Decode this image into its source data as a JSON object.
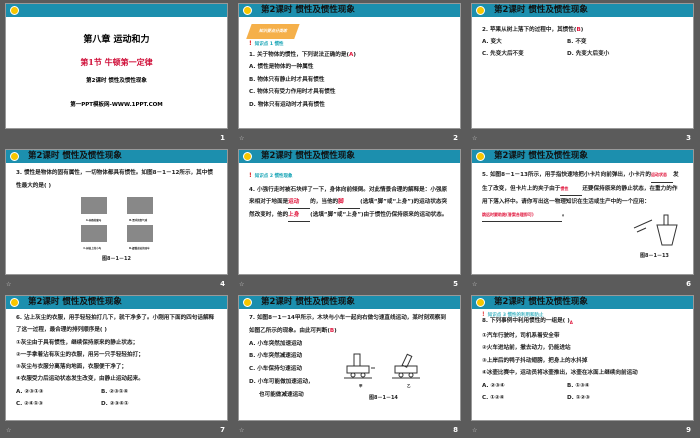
{
  "header_title": "第2课时  惯性及惯性现象",
  "slides": [
    {
      "num": "1",
      "chapter": "第八章  运动和力",
      "section": "第1节  牛顿第一定律",
      "lesson": "第2课时  惯性及惯性现象",
      "site": "第一PPT模板网-WWW.1PPT.COM"
    },
    {
      "num": "2",
      "banner": "知识要点分类练",
      "kp": "知识点 1  惯性",
      "q": "1. 关于物体的惯性，下列说法正确的是(",
      "ans": "A",
      "q_end": ")",
      "opts": [
        "A. 惯性是物体的一种属性",
        "B. 物体只有静止时才具有惯性",
        "C. 物体只有受力作用时才具有惯性",
        "D. 物体只有运动时才具有惯性"
      ]
    },
    {
      "num": "3",
      "q": "2. 苹果从树上落下的过程中，其惯性(",
      "ans": "B",
      "q_end": ")",
      "opts": [
        "A. 变大",
        "B. 不变",
        "C. 先变大后不变",
        "D. 先变大后变小"
      ]
    },
    {
      "num": "4",
      "q": "3. 惯性是物体的固有属性，一切物体都具有惯性。如图8－1－12所示，其中惯性最大的是(  )",
      "fig": "图8－1－12",
      "imgs": [
        "A.奔跑的骏马",
        "B.漂浮的氢气球",
        "C.树枝上的小鸟",
        "D.缓慢进站的动车"
      ]
    },
    {
      "num": "5",
      "kp": "知识点 2  惯性现象",
      "t1": "4. 小强行走时被石块绊了一下，身体向前倾倒。对此情景合理的解释是：小强原来相对于地面是",
      "a1": "运动",
      "t2": "的，当他的",
      "a2": "脚",
      "t3": "(选填“脚”或“上身”)的运动状态突然改变时，他的",
      "a3": "上身",
      "t4": "(选填“脚”或“上身”)由于惯性仍保持原来的运动状态。"
    },
    {
      "num": "6",
      "t1": "5. 如图8－1－13所示，用手指快速地把小卡片向前弹出，小卡片的",
      "a1": "运动状态",
      "t2": "发生了改变，但卡片上的夹子由于",
      "a2": "惯性",
      "t3": "还要保持原来的静止状态，在重力的作用下落入杯中。请你写出这一物理知识在生活或生产中的一个应用：",
      "a3": "跳远时要助跑(答案合理即可)",
      "t4": "。",
      "fig": "图8－1－13"
    },
    {
      "num": "7",
      "q": "6. 沾上灰尘的衣服，用手轻轻拍打几下，就干净多了。小刚用下面的四句话解释了这一过程，最合理的排列顺序是(  )",
      "items": [
        "①灰尘由于具有惯性，继续保持原来的静止状态；",
        "②一手拿着沾有灰尘的衣服，用另一只手轻轻拍打；",
        "③灰尘与衣服分离落向地面，衣服便干净了；",
        "④衣服受力后运动状态发生改变，由静止运动起来。"
      ],
      "opts": [
        "A. ②③①③",
        "B. ②③①④",
        "C. ②④①③",
        "D. ②③④①"
      ]
    },
    {
      "num": "8",
      "q": "7. 如图8－1－14甲所示，木块与小车一起向右做匀速直线运动，某时刻观察到如图乙所示的现象。由此可判断(",
      "ans": "B",
      "q_end": ")",
      "opts": [
        "A. 小车突然加速运动",
        "B. 小车突然减速运动",
        "C. 小车保持匀速运动",
        "D. 小车可能做加速运动，",
        "    也可能做减速运动"
      ],
      "fig": "图8－1－14",
      "labels": [
        "甲",
        "乙"
      ]
    },
    {
      "num": "9",
      "kp": "知识点 3  惯性的利用和防止",
      "q": "8. 下列事例中利用惯性的一组是(  )",
      "ans": "A",
      "items": [
        "①汽车行驶时，司机系着安全带",
        "②火车进站前，撤去动力，仍能进站",
        "③上岸后的鸭子抖动翅膀，把身上的水抖掉",
        "④冰壶比赛中，运动员将冰壶推出，冰壶在冰面上继续向前运动"
      ],
      "opts": [
        "A. ②③④",
        "B. ①③④",
        "C. ①②④",
        "D. ①②③"
      ]
    }
  ],
  "colors": {
    "header": "#1c8fae",
    "answer": "#e0163c",
    "title_red": "#d0103a"
  }
}
